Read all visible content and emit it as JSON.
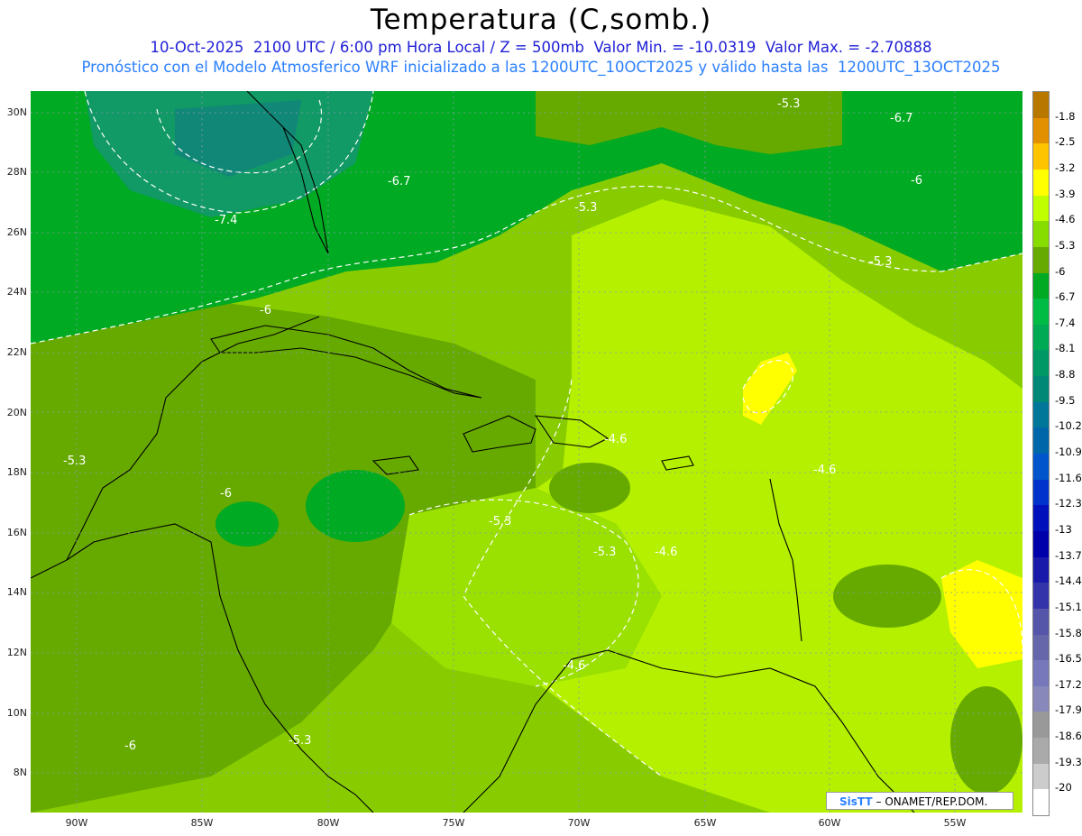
{
  "title": "Temperatura (C,somb.)",
  "subtitle_line1": "10-Oct-2025  2100 UTC / 6:00 pm Hora Local / Z = 500mb  Valor Min. = -10.0319  Valor Max. = -2.70888",
  "subtitle_line2": "Pronóstico con el Modelo Atmosferico WRF inicializado a las 1200UTC_10OCT2025 y válido hasta las  1200UTC_13OCT2025",
  "lat_labels": [
    "30N",
    "28N",
    "26N",
    "24N",
    "22N",
    "20N",
    "18N",
    "16N",
    "14N",
    "12N",
    "10N",
    "8N"
  ],
  "lon_labels": [
    "90W",
    "85W",
    "80W",
    "75W",
    "70W",
    "65W",
    "60W",
    "55W"
  ],
  "legend": {
    "labels": [
      "-1.8",
      "-2.5",
      "-3.2",
      "-3.9",
      "-4.6",
      "-5.3",
      "-6",
      "-6.7",
      "-7.4",
      "-8.1",
      "-8.8",
      "-9.5",
      "-10.2",
      "-10.9",
      "-11.6",
      "-12.3",
      "-13",
      "-13.7",
      "-14.4",
      "-15.1",
      "-15.8",
      "-16.5",
      "-17.2",
      "-17.9",
      "-18.6",
      "-19.3",
      "-20"
    ],
    "colors": [
      "#b87800",
      "#e29000",
      "#ffc400",
      "#ffff00",
      "#c0ff00",
      "#88dd00",
      "#66aa00",
      "#00aa22",
      "#00bb44",
      "#00aa55",
      "#009966",
      "#008877",
      "#007799",
      "#0066aa",
      "#0055cc",
      "#0033cc",
      "#0011bb",
      "#0000aa",
      "#1a1aaa",
      "#3333aa",
      "#5555aa",
      "#6666aa",
      "#7777bb",
      "#8888bb",
      "#999999",
      "#aaaaaa",
      "#cccccc",
      "#ffffff"
    ]
  },
  "contour_labels": [
    "-5.3",
    "-6.7",
    "-6",
    "-6.7",
    "-5.3",
    "-7.4",
    "-6",
    "-5.3",
    "-5.3",
    "-6",
    "-4.6",
    "-4.6",
    "-5.3",
    "-5.3",
    "-4.6",
    "-4.6",
    "-6",
    "-5.3"
  ],
  "credit": {
    "brand": "SisTT",
    "text": "– ONAMET/REP.DOM."
  }
}
